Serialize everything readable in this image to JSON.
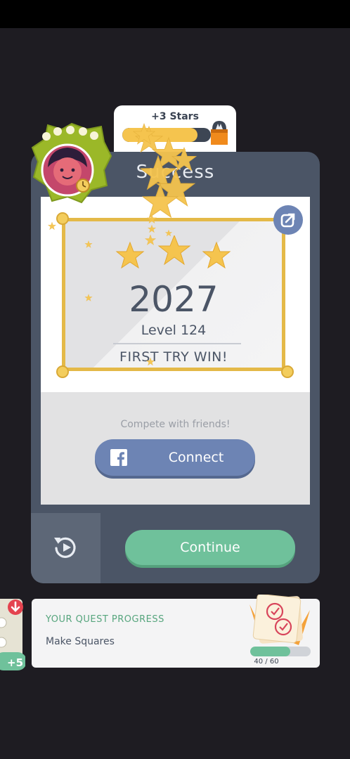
{
  "stars_reward": {
    "label": "+3 Stars",
    "progress": 0.85
  },
  "result": {
    "title": "Success",
    "score": "2027",
    "level": "Level 124",
    "message": "FIRST TRY WIN!",
    "stars_earned": 3
  },
  "social": {
    "prompt": "Compete with friends!",
    "connect_label": "Connect"
  },
  "actions": {
    "continue_label": "Continue"
  },
  "quest": {
    "title": "YOUR QUEST PROGRESS",
    "name": "Make Squares",
    "count": "40 / 60",
    "progress": 0.667
  },
  "side_tab": {
    "label": "+5"
  },
  "colors": {
    "background": "#1e1c22",
    "card": "#4b5566",
    "gold": "#f5c44e",
    "facebook": "#6d84b4",
    "continue": "#6fc19b",
    "quest_green": "#56a57d",
    "badge_green": "#9bb828"
  }
}
